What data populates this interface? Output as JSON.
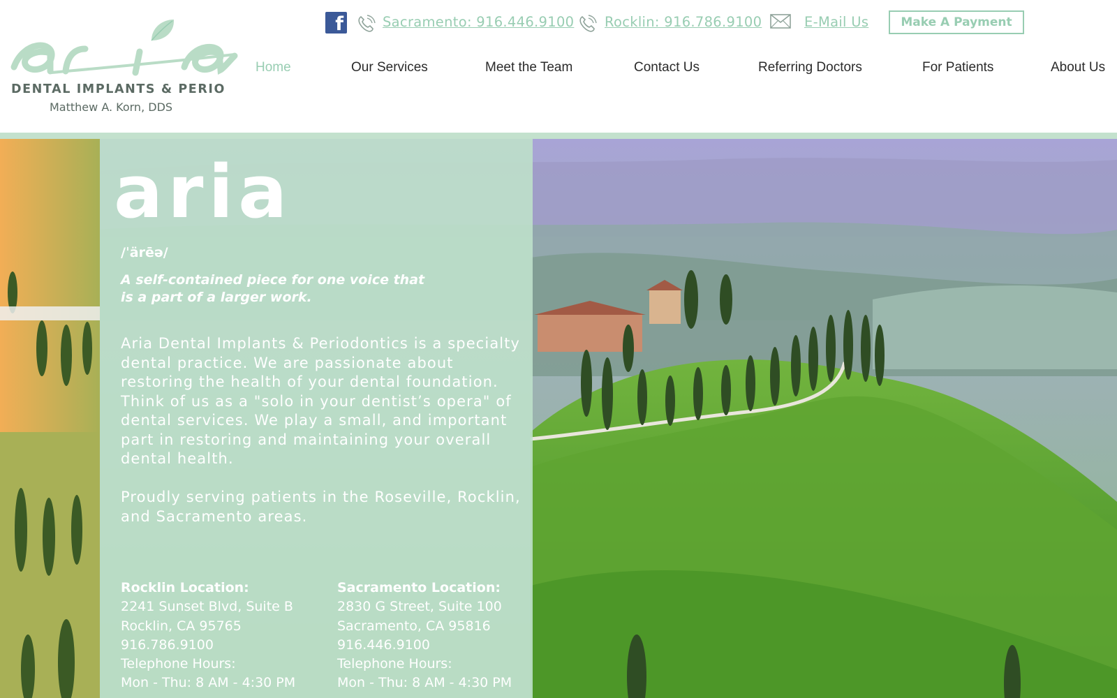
{
  "logo": {
    "wordmark": "aria",
    "line1": "DENTAL IMPLANTS & PERIO",
    "line2": "Matthew A. Korn, DDS"
  },
  "topbar": {
    "facebook_icon": "facebook-icon",
    "sacramento_phone": "Sacramento: 916.446.9100",
    "rocklin_phone": "Rocklin: 916.786.9100",
    "email": "E-Mail Us",
    "payment_button": "Make A Payment"
  },
  "nav": {
    "items": [
      {
        "label": "Home",
        "active": true
      },
      {
        "label": "Our Services"
      },
      {
        "label": "Meet the Team"
      },
      {
        "label": "Contact Us"
      },
      {
        "label": "Referring Doctors"
      },
      {
        "label": "For Patients"
      },
      {
        "label": "About Us"
      }
    ]
  },
  "hero": {
    "word": "aria",
    "phonetic": "/ˈärēə/",
    "definition": "A self-contained piece for one voice that is a part of a larger work.",
    "about": "Aria Dental Implants & Periodontics is a specialty dental practice.  We are passionate about restoring the health of your dental foundation.  Think of us as a \"solo in your dentist’s opera\" of dental services. We play a small, and important part in restoring and maintaining your overall dental health.",
    "serving": "Proudly serving patients in the Roseville, Rocklin, and Sacramento areas."
  },
  "locations": [
    {
      "title": "Rocklin Location:",
      "street": "2241 Sunset Blvd, Suite B",
      "city": "Rocklin, CA 95765",
      "phone": "916.786.9100",
      "hours_label": "Telephone Hours:",
      "hours": "Mon - Thu: 8 AM - 4:30 PM"
    },
    {
      "title": "Sacramento Location:",
      "street": "2830 G Street, Suite 100",
      "city": "Sacramento, CA 95816",
      "phone": "916.446.9100",
      "hours_label": "Telephone Hours:",
      "hours": "Mon - Thu: 8 AM - 4:30 PM"
    }
  ],
  "colors": {
    "brand_green": "#98cdb2",
    "panel_green": "#bee0ca",
    "facebook_blue": "#3b5998",
    "nav_text": "#2b2b2b"
  }
}
